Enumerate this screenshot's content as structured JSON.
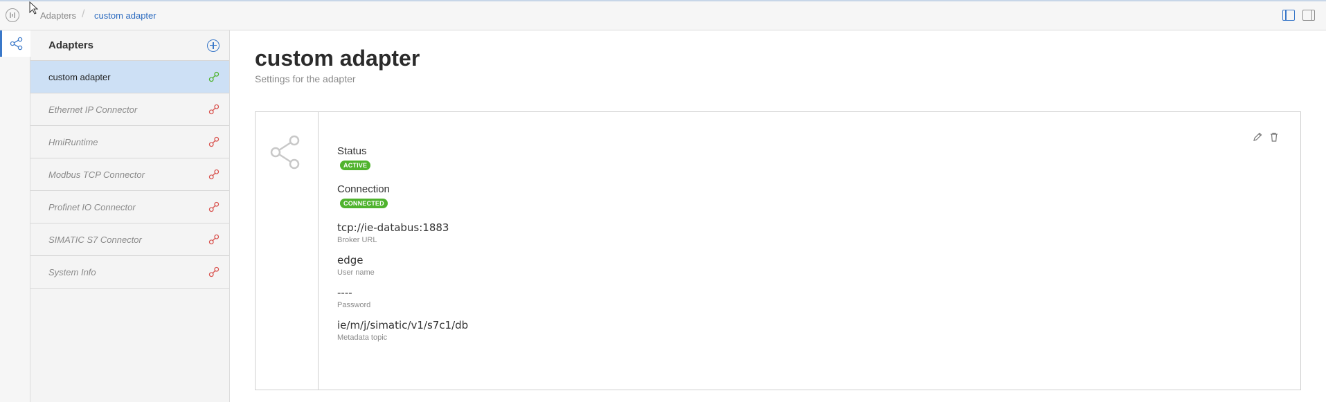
{
  "breadcrumb": {
    "root": "Adapters",
    "separator": "/",
    "current": "custom adapter"
  },
  "sidebar": {
    "title": "Adapters",
    "add_icon": "add-circle-icon",
    "items": [
      {
        "label": "custom adapter",
        "selected": true,
        "link_color": "#4fb32d"
      },
      {
        "label": "Ethernet IP Connector",
        "selected": false,
        "link_color": "#d9534f"
      },
      {
        "label": "HmiRuntime",
        "selected": false,
        "link_color": "#d9534f"
      },
      {
        "label": "Modbus TCP Connector",
        "selected": false,
        "link_color": "#d9534f"
      },
      {
        "label": "Profinet IO Connector",
        "selected": false,
        "link_color": "#d9534f"
      },
      {
        "label": "SIMATIC S7 Connector",
        "selected": false,
        "link_color": "#d9534f"
      },
      {
        "label": "System Info",
        "selected": false,
        "link_color": "#d9534f"
      }
    ]
  },
  "page": {
    "title": "custom adapter",
    "subtitle": "Settings for the adapter"
  },
  "details": {
    "status_heading": "Status",
    "status_badge": "ACTIVE",
    "connection_heading": "Connection",
    "connection_badge": "CONNECTED",
    "fields": [
      {
        "value": "tcp://ie-databus:1883",
        "label": "Broker URL"
      },
      {
        "value": "edge",
        "label": "User name"
      },
      {
        "value": "----",
        "label": "Password"
      },
      {
        "value": "ie/m/j/simatic/v1/s7c1/db",
        "label": "Metadata topic"
      }
    ]
  },
  "colors": {
    "accent": "#3a78c9",
    "selected_row": "#cde0f5",
    "badge_green": "#4fb32d",
    "disconnected_red": "#d9534f"
  }
}
